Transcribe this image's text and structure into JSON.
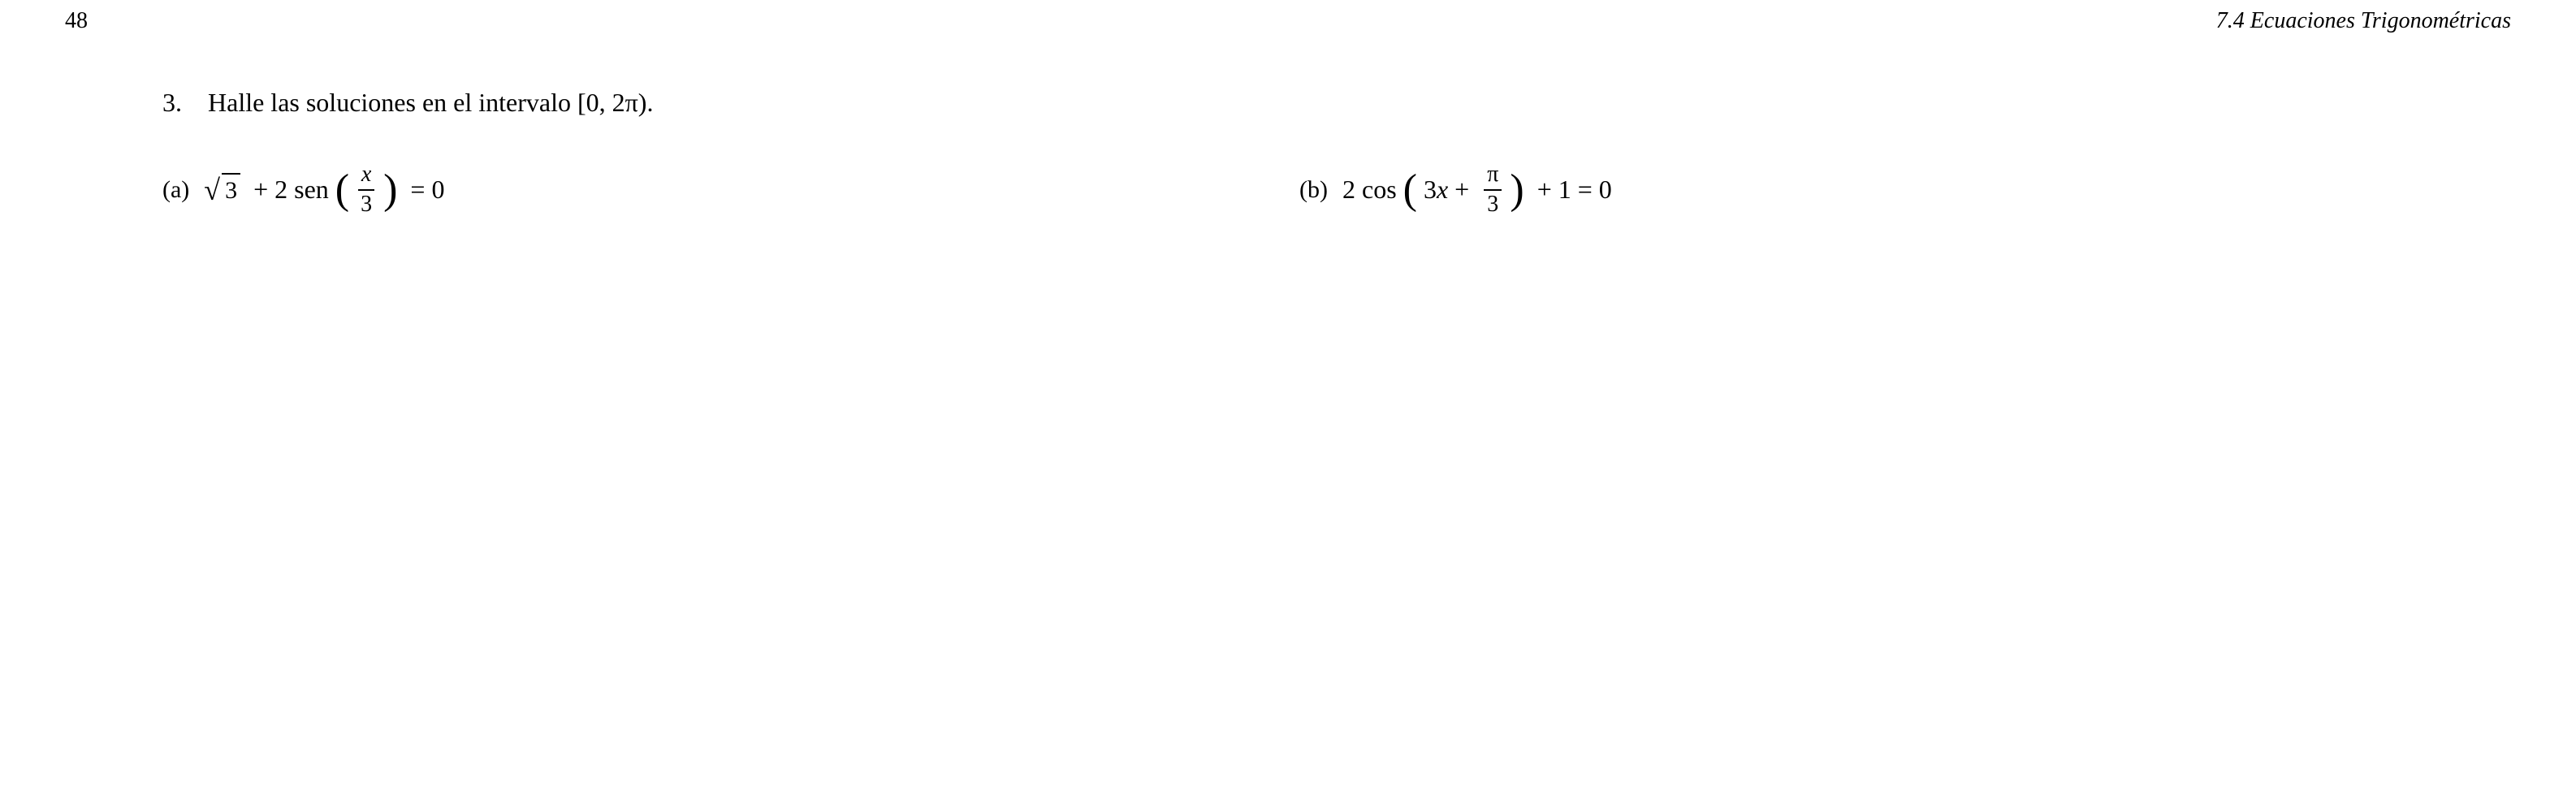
{
  "header": {
    "page_number": "48",
    "chapter_title": "7.4 Ecuaciones Trigonométricas"
  },
  "problem": {
    "number": "3.",
    "instruction": "Halle las soluciones en el intervalo [0, 2π).",
    "parts": [
      {
        "label": "(a)",
        "math_display": "√3 + 2 sen(x/3) = 0"
      },
      {
        "label": "(b)",
        "math_display": "2 cos(3x + π/3) + 1 = 0"
      }
    ]
  }
}
